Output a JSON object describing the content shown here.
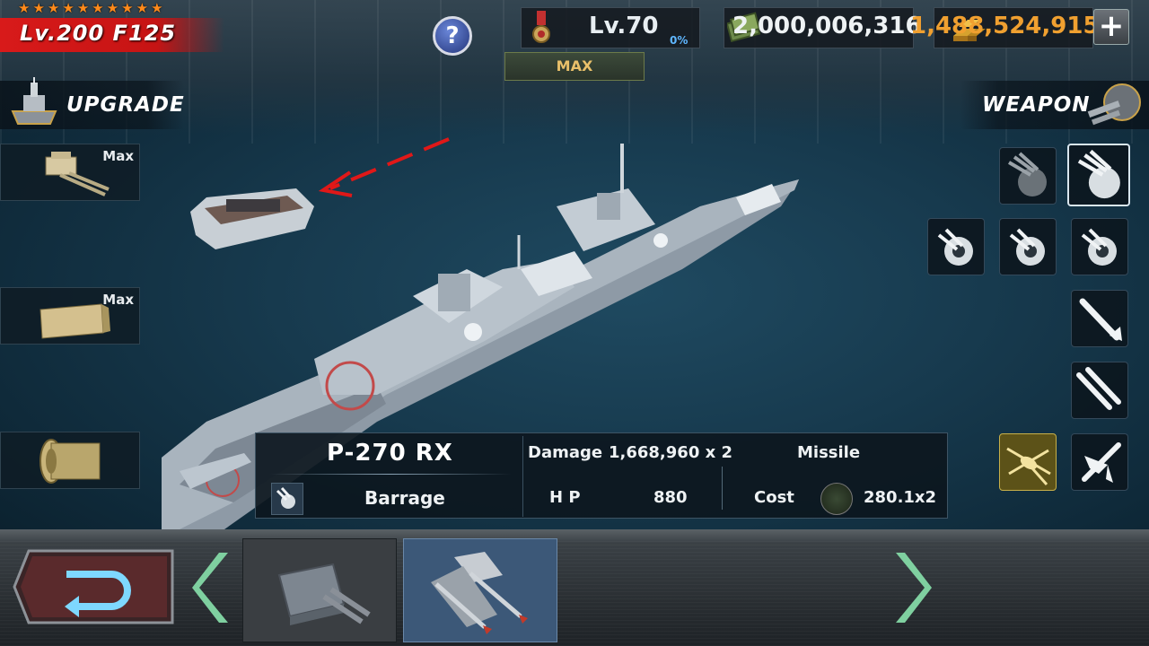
{
  "hud": {
    "stars": [
      "★",
      "★",
      "★",
      "★",
      "★",
      "★",
      "★",
      "★",
      "★",
      "★"
    ],
    "ship_level": "Lv.200 F125",
    "help_label": "?",
    "rank_level": "Lv.70",
    "rank_percent": "0%",
    "rank_status": "MAX",
    "cash": "2,000,006,316",
    "gold": "1,488,524,915",
    "add_label": "+"
  },
  "left_panel": {
    "title": "UPGRADE",
    "slots": [
      {
        "icon": "main-gun-icon",
        "status": "Max"
      },
      {
        "icon": "armor-plate-icon",
        "status": "Max"
      },
      {
        "icon": "engine-icon",
        "status": ""
      }
    ]
  },
  "right_panel": {
    "title": "WEAPON",
    "slots": [
      {
        "icon": "triple-cannon-icon",
        "selected": false
      },
      {
        "icon": "triple-cannon-icon",
        "selected": true
      },
      {
        "icon": "gatling-icon",
        "selected": false
      },
      {
        "icon": "gatling-icon",
        "selected": false
      },
      {
        "icon": "gatling-icon",
        "selected": false
      },
      {
        "icon": "missile-icon",
        "selected": false
      },
      {
        "icon": "double-missile-icon",
        "selected": false
      },
      {
        "icon": "helicopter-icon",
        "selected": false
      },
      {
        "icon": "airplane-icon",
        "selected": false
      }
    ]
  },
  "weapon_info": {
    "name": "P-270 RX",
    "type_label": "Barrage",
    "damage_label": "Damage",
    "damage_value": "1,668,960 x 2",
    "hp_label": "H P",
    "hp_value": "880",
    "category": "Missile",
    "cost_label": "Cost",
    "cost_value": "280.1x2"
  },
  "bottom_bar": {
    "tabs": [
      {
        "icon": "turret-icon",
        "selected": false
      },
      {
        "icon": "missile-launcher-icon",
        "selected": true
      }
    ]
  },
  "colors": {
    "level_banner": "#d81a1a",
    "gold_text": "#f0a030",
    "selected_tab": "#3c5878",
    "nav_arrow": "#7fd0a0"
  }
}
